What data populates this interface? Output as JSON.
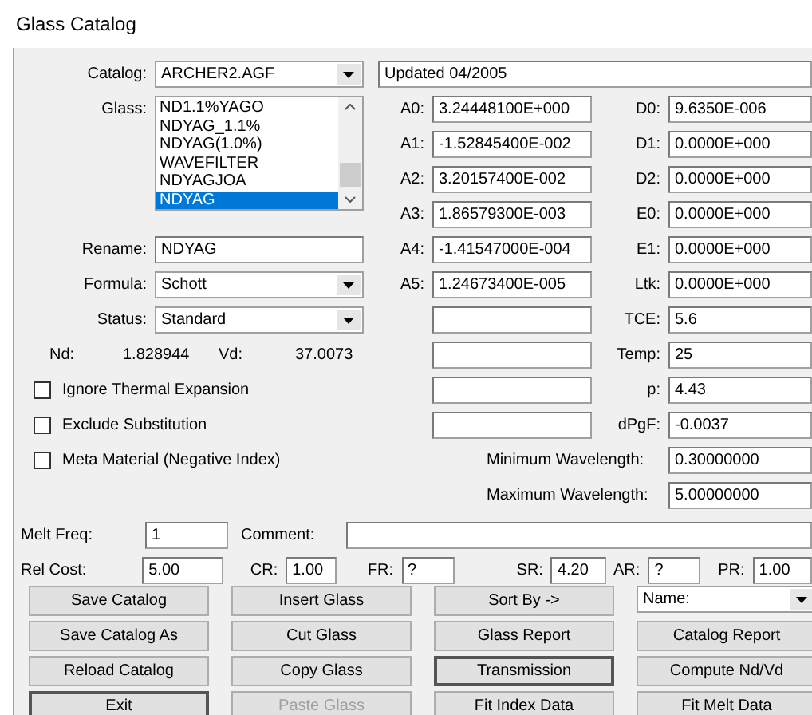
{
  "window": {
    "title": "Glass Catalog"
  },
  "catalog": {
    "label": "Catalog:",
    "value": "ARCHER2.AGF",
    "note": "Updated 04/2005"
  },
  "glass": {
    "label": "Glass:",
    "items": [
      {
        "label": "ND1.1%YAGO",
        "selected": false
      },
      {
        "label": "NDYAG_1.1%",
        "selected": false
      },
      {
        "label": "NDYAG(1.0%)",
        "selected": false
      },
      {
        "label": "WAVEFILTER",
        "selected": false
      },
      {
        "label": "NDYAGJOA",
        "selected": false
      },
      {
        "label": "NDYAG",
        "selected": true
      }
    ]
  },
  "rename": {
    "label": "Rename:",
    "value": "NDYAG"
  },
  "formula": {
    "label": "Formula:",
    "value": "Schott"
  },
  "status": {
    "label": "Status:",
    "value": "Standard"
  },
  "nd": {
    "label": "Nd:",
    "value": "1.828944"
  },
  "vd": {
    "label": "Vd:",
    "value": "37.0073"
  },
  "checkboxes": [
    {
      "label": "Ignore Thermal Expansion",
      "checked": false
    },
    {
      "label": "Exclude Substitution",
      "checked": false
    },
    {
      "label": "Meta Material (Negative Index)",
      "checked": false
    }
  ],
  "coefficients": [
    {
      "label": "A0:",
      "value": "3.24448100E+000"
    },
    {
      "label": "A1:",
      "value": "-1.52845400E-002"
    },
    {
      "label": "A2:",
      "value": "3.20157400E-002"
    },
    {
      "label": "A3:",
      "value": "1.86579300E-003"
    },
    {
      "label": "A4:",
      "value": "-1.41547000E-004"
    },
    {
      "label": "A5:",
      "value": "1.24673400E-005"
    }
  ],
  "properties": [
    {
      "label": "D0:",
      "value": "9.6350E-006"
    },
    {
      "label": "D1:",
      "value": "0.0000E+000"
    },
    {
      "label": "D2:",
      "value": "0.0000E+000"
    },
    {
      "label": "E0:",
      "value": "0.0000E+000"
    },
    {
      "label": "E1:",
      "value": "0.0000E+000"
    },
    {
      "label": "Ltk:",
      "value": "0.0000E+000"
    },
    {
      "label": "TCE:",
      "value": "5.6"
    },
    {
      "label": "Temp:",
      "value": "25"
    },
    {
      "label": "p:",
      "value": "4.43"
    },
    {
      "label": "dPgF:",
      "value": "-0.0037"
    }
  ],
  "wavelengths": [
    {
      "label": "Minimum Wavelength:",
      "value": "0.30000000"
    },
    {
      "label": "Maximum Wavelength:",
      "value": "5.00000000"
    }
  ],
  "melt_freq": {
    "label": "Melt Freq:",
    "value": "1"
  },
  "comment": {
    "label": "Comment:"
  },
  "costs": [
    {
      "label": "Rel Cost:",
      "value": "5.00"
    },
    {
      "label": "CR:",
      "value": "1.00"
    },
    {
      "label": "FR:",
      "value": "?"
    },
    {
      "label": "SR:",
      "value": "4.20"
    },
    {
      "label": "AR:",
      "value": "?"
    },
    {
      "label": "PR:",
      "value": "1.00"
    }
  ],
  "buttons": [
    {
      "kind": "button",
      "label": "Save Catalog",
      "default": false,
      "disabled": false
    },
    {
      "kind": "button",
      "label": "Insert Glass",
      "default": false,
      "disabled": false
    },
    {
      "kind": "button",
      "label": "Sort By ->",
      "default": false,
      "disabled": false
    },
    {
      "kind": "dropdown",
      "label": "Name:"
    },
    {
      "kind": "button",
      "label": "Save Catalog As",
      "default": false,
      "disabled": false
    },
    {
      "kind": "button",
      "label": "Cut Glass",
      "default": false,
      "disabled": false
    },
    {
      "kind": "button",
      "label": "Glass Report",
      "default": false,
      "disabled": false
    },
    {
      "kind": "button",
      "label": "Catalog Report",
      "default": false,
      "disabled": false
    },
    {
      "kind": "button",
      "label": "Reload Catalog",
      "default": false,
      "disabled": false
    },
    {
      "kind": "button",
      "label": "Copy Glass",
      "default": false,
      "disabled": false
    },
    {
      "kind": "button",
      "label": "Transmission",
      "default": true,
      "disabled": false
    },
    {
      "kind": "button",
      "label": "Compute Nd/Vd",
      "default": false,
      "disabled": false
    },
    {
      "kind": "button",
      "label": "Exit",
      "default": true,
      "disabled": false
    },
    {
      "kind": "button",
      "label": "Paste Glass",
      "default": false,
      "disabled": true
    },
    {
      "kind": "button",
      "label": "Fit Index Data",
      "default": false,
      "disabled": false
    },
    {
      "kind": "button",
      "label": "Fit Melt Data",
      "default": false,
      "disabled": false
    }
  ]
}
